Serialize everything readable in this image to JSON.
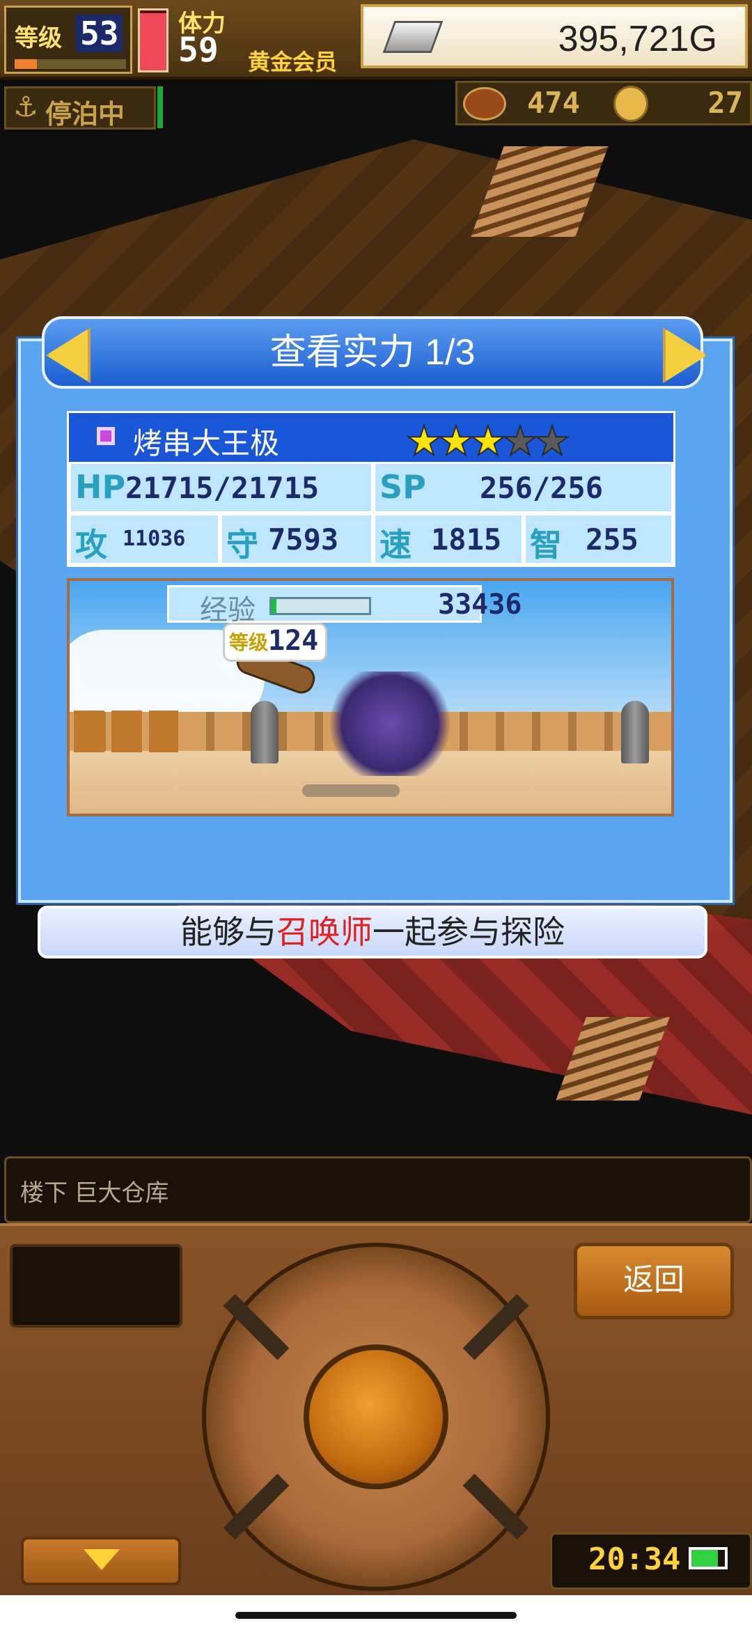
{
  "top": {
    "level_label": "等级",
    "level_value": "53",
    "level_progress": 0.2,
    "stamina_label": "体力",
    "stamina_value": "59",
    "stamina_fill": 0.95,
    "member_label": "黄金会员",
    "gold": "395,721G",
    "status_label": "停泊中",
    "meat_count": "474",
    "coin_count": "27"
  },
  "modal": {
    "title": "查看实力 1/3",
    "character_name": "烤串大王极",
    "stars_filled": 3,
    "stars_total": 5,
    "stats": {
      "hp_label": "HP",
      "hp_value": "21715/21715",
      "sp_label": "SP",
      "sp_value": "256/256",
      "atk_label": "攻",
      "atk_value": "11036",
      "def_label": "守",
      "def_value": "7593",
      "spd_label": "速",
      "spd_value": "1815",
      "int_label": "智",
      "int_value": "255"
    },
    "exp_label": "经验",
    "exp_value": "33436",
    "exp_progress": 0.05,
    "level_label": "等级",
    "level_value": "124"
  },
  "description": {
    "before": "能够与",
    "highlight": "召唤师",
    "after": "一起参与探险"
  },
  "bottom": {
    "location": "楼下 巨大仓库",
    "back_label": "返回",
    "time": "20:34"
  },
  "colors": {
    "modal_blue": "#5aa4f0",
    "header_blue": "#1a56d8",
    "star_gold": "#ffe30a",
    "highlight_red": "#e02020"
  }
}
